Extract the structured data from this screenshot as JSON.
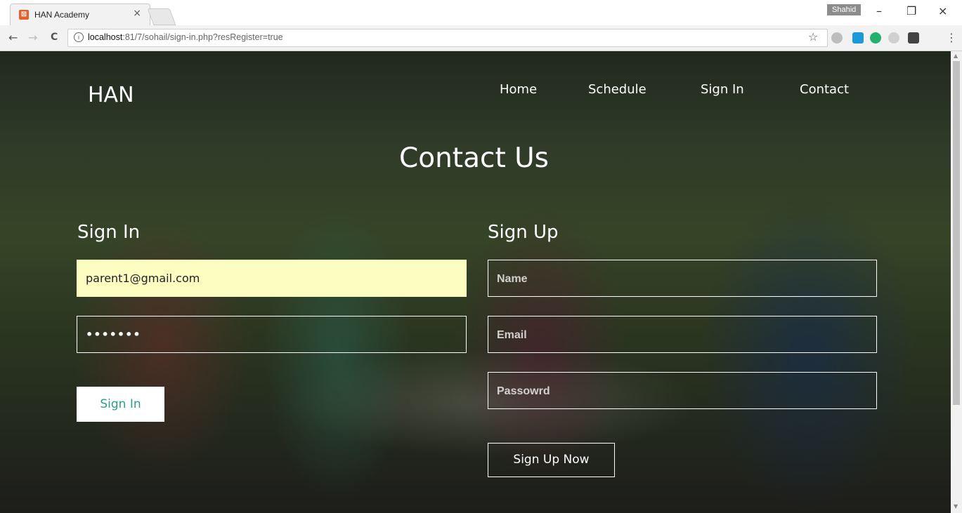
{
  "browser": {
    "tab_title": "HAN Academy",
    "tab_close": "×",
    "profile_name": "Shahid",
    "url_host": "localhost",
    "url_path": ":81/7/sohail/sign-in.php?resRegister=true",
    "back": "←",
    "forward": "→",
    "reload": "C",
    "info": "i",
    "star": "☆",
    "minimize": "–",
    "restore": "❐",
    "close": "×",
    "menu": "⋮"
  },
  "site": {
    "brand": "HAN",
    "nav": [
      "Home",
      "Schedule",
      "Sign In",
      "Contact"
    ],
    "page_title": "Contact Us"
  },
  "signin": {
    "title": "Sign In",
    "email_value": "parent1@gmail.com",
    "password_value": "•••••••",
    "button": "Sign In"
  },
  "signup": {
    "title": "Sign Up",
    "name_placeholder": "Name",
    "email_placeholder": "Email",
    "password_placeholder": "Passowrd",
    "button": "Sign Up Now"
  },
  "colors": {
    "accent": "#2aa08a",
    "autofill": "#fbfdc1"
  }
}
